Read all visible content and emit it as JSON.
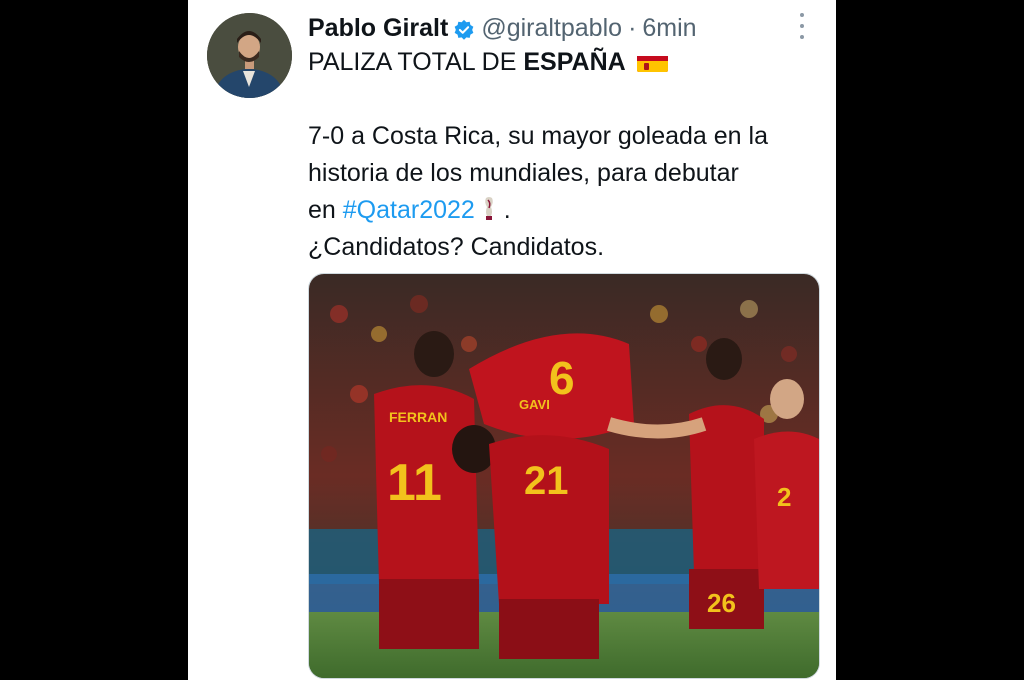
{
  "tweet": {
    "author_name": "Pablo Giralt",
    "handle": "@giraltpablo",
    "separator": "·",
    "time": "6min",
    "headline_prefix": "PALIZA TOTAL DE ",
    "headline_bold": "ESPAÑA",
    "body_lines": [
      "7-0 a Costa Rica, su mayor goleada en la",
      "historia de los mundiales, para debutar"
    ],
    "body_line3_prefix": "en ",
    "hashtag": "#Qatar2022",
    "body_line3_suffix": " .",
    "body_line4": "¿Candidatos? Candidatos.",
    "icons": {
      "verified": "verified-badge-icon",
      "more": "more-options-icon",
      "flag": "spain-flag-icon",
      "trophy": "world-cup-trophy-icon"
    }
  },
  "photo": {
    "jersey_numbers": [
      "11",
      "6",
      "2",
      "26",
      "21"
    ],
    "jersey_names": [
      "FERRAN",
      "GAVI"
    ]
  },
  "colors": {
    "background": "#000000",
    "card": "#ffffff",
    "text": "#0f1419",
    "secondary": "#536471",
    "link": "#1d9bf0",
    "jersey_red": "#b5121b",
    "jersey_yellow": "#f2c21c"
  }
}
